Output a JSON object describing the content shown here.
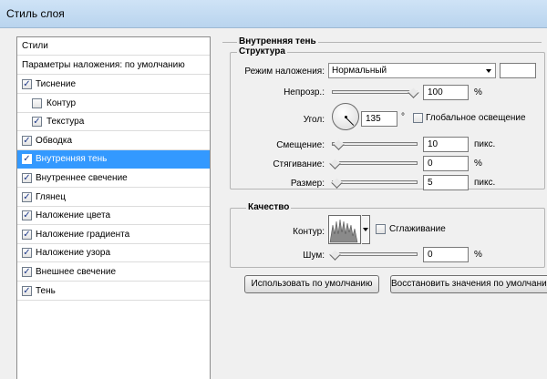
{
  "window": {
    "title": "Стиль слоя"
  },
  "sidebar": {
    "header": "Стили",
    "blending": "Параметры наложения: по умолчанию",
    "items": [
      {
        "label": "Тиснение",
        "checked": true
      },
      {
        "label": "Контур",
        "checked": false
      },
      {
        "label": "Текстура",
        "checked": true
      },
      {
        "label": "Обводка",
        "checked": true
      },
      {
        "label": "Внутренняя тень",
        "checked": true,
        "selected": true
      },
      {
        "label": "Внутреннее свечение",
        "checked": true
      },
      {
        "label": "Глянец",
        "checked": true
      },
      {
        "label": "Наложение цвета",
        "checked": true
      },
      {
        "label": "Наложение градиента",
        "checked": true
      },
      {
        "label": "Наложение узора",
        "checked": true
      },
      {
        "label": "Внешнее свечение",
        "checked": true
      },
      {
        "label": "Тень",
        "checked": true
      }
    ],
    "check_mark": "✓"
  },
  "panel": {
    "title": "Внутренняя тень",
    "structure": {
      "title": "Структура",
      "blend_mode_label": "Режим наложения:",
      "blend_mode_value": "Нормальный",
      "opacity_label": "Непрозр.:",
      "opacity_value": "100",
      "opacity_unit": "%",
      "angle_label": "Угол:",
      "angle_value": "135",
      "angle_unit": "°",
      "global_light_label": "Глобальное освещение",
      "global_light_checked": false,
      "distance_label": "Смещение:",
      "distance_value": "10",
      "distance_unit": "пикс.",
      "choke_label": "Стягивание:",
      "choke_value": "0",
      "choke_unit": "%",
      "size_label": "Размер:",
      "size_value": "5",
      "size_unit": "пикс."
    },
    "quality": {
      "title": "Качество",
      "contour_label": "Контур:",
      "antialias_label": "Сглаживание",
      "antialias_checked": false,
      "noise_label": "Шум:",
      "noise_value": "0",
      "noise_unit": "%"
    },
    "buttons": {
      "make_default": "Использовать по умолчанию",
      "reset_default": "Восстановить значения по умолчанию"
    }
  },
  "sliders": {
    "opacity": 1.0,
    "distance": 0.05,
    "choke": 0.0,
    "size": 0.02,
    "noise": 0.0
  },
  "colors": {
    "selection": "#3399ff",
    "shadow_swatch": "#ffffff"
  }
}
